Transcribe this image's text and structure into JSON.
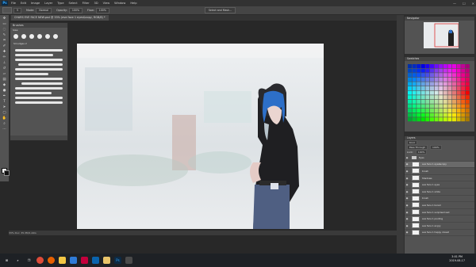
{
  "app": {
    "logo": "Ps"
  },
  "menu": [
    "File",
    "Edit",
    "Image",
    "Layer",
    "Type",
    "Select",
    "Filter",
    "3D",
    "View",
    "Window",
    "Help"
  ],
  "window_controls": [
    "—",
    "☐",
    "✕"
  ],
  "options_bar": {
    "size": "5",
    "mode_label": "Mode:",
    "mode_value": "Normal",
    "opacity_label": "Opacity:",
    "opacity_value": "100%",
    "flow_label": "Flow:",
    "flow_value": "100%",
    "select_mask": "Select and Mask..."
  },
  "document_tab": "CHARS EVE FACE NEW.psd @ 33% (eve face 1 eyes&copy, RGB/8) *",
  "brushes_panel": {
    "title": "Brushes",
    "size_label": "Size:",
    "group": "Smudges 2"
  },
  "status": "33%     Doc: 35.3M/1.44G",
  "navigator_title": "Navigator",
  "swatches_title": "Swatches",
  "layers_panel": {
    "title": "Layers",
    "kind": "Kind",
    "blend": "Pass Through",
    "opacity": "100%",
    "lock": "Lock:",
    "fill": "100%",
    "rows": [
      {
        "name": "Eyes",
        "type": "folder",
        "selected": false
      },
      {
        "name": "eve face 1 eyes&copy",
        "type": "layer",
        "selected": true
      },
      {
        "name": "brush",
        "type": "layer",
        "selected": false
      },
      {
        "name": "Shadows",
        "type": "layer",
        "selected": false
      },
      {
        "name": "eve face 1 eyes",
        "type": "layer",
        "selected": false
      },
      {
        "name": "eve face 1 smile",
        "type": "layer",
        "selected": false
      },
      {
        "name": "brush",
        "type": "layer",
        "selected": false
      },
      {
        "name": "eve face 1 bored",
        "type": "layer",
        "selected": false
      },
      {
        "name": "eve face 1 surprised sad",
        "type": "layer",
        "selected": false
      },
      {
        "name": "eve face 1 pouting",
        "type": "layer",
        "selected": false
      },
      {
        "name": "eve face 1 angry",
        "type": "layer",
        "selected": false
      },
      {
        "name": "eve face 1 happy closed",
        "type": "layer",
        "selected": false
      }
    ]
  },
  "colors": {
    "accent": "#31a8ff",
    "hair": "#2d6fc8",
    "hoodie": "#1f1f22"
  },
  "taskbar": {
    "time": "3:01 PM",
    "date": "2019-08-17",
    "icons": [
      "windows-icon",
      "search-icon",
      "task-view-icon",
      "chrome-icon",
      "firefox-icon",
      "file-explorer-icon",
      "store-icon",
      "media-icon",
      "mail-icon",
      "folder-icon",
      "photoshop-icon",
      "app-icon"
    ]
  }
}
